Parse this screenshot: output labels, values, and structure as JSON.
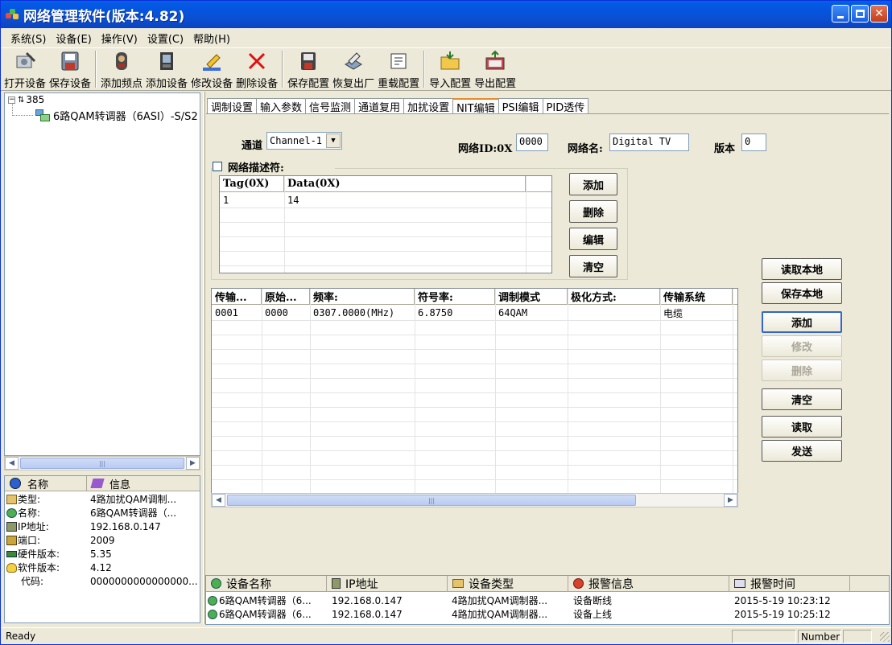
{
  "window": {
    "title": "网络管理软件(版本:4.82)"
  },
  "menu": [
    "系统(S)",
    "设备(E)",
    "操作(V)",
    "设置(C)",
    "帮助(H)"
  ],
  "toolbar": [
    {
      "label": "打开设备",
      "icon": "open-device-icon"
    },
    {
      "label": "保存设备",
      "icon": "save-device-icon"
    },
    {
      "label": "添加频点",
      "icon": "add-frequency-icon"
    },
    {
      "label": "添加设备",
      "icon": "add-device-icon"
    },
    {
      "label": "修改设备",
      "icon": "edit-device-icon"
    },
    {
      "label": "删除设备",
      "icon": "delete-device-icon"
    },
    {
      "label": "保存配置",
      "icon": "save-config-icon"
    },
    {
      "label": "恢复出厂",
      "icon": "factory-reset-icon"
    },
    {
      "label": "重载配置",
      "icon": "reload-config-icon"
    },
    {
      "label": "导入配置",
      "icon": "import-config-icon"
    },
    {
      "label": "导出配置",
      "icon": "export-config-icon"
    }
  ],
  "tree": {
    "root": "385",
    "child": "6路QAM转调器（6ASI）-S/S2"
  },
  "info": {
    "headers": [
      "名称",
      "信息"
    ],
    "rows": [
      {
        "k": "类型:",
        "v": "4路加扰QAM调制..."
      },
      {
        "k": "名称:",
        "v": "6路QAM转调器（..."
      },
      {
        "k": "IP地址:",
        "v": "192.168.0.147"
      },
      {
        "k": "端口:",
        "v": "2009"
      },
      {
        "k": "硬件版本:",
        "v": "5.35"
      },
      {
        "k": "软件版本:",
        "v": "4.12"
      },
      {
        "k": "代码:",
        "v": "0000000000000000..."
      }
    ]
  },
  "tabs": [
    "调制设置",
    "输入参数",
    "信号监测",
    "通道复用",
    "加扰设置",
    "NIT编辑",
    "PSI编辑",
    "PID透传"
  ],
  "active_tab": "NIT编辑",
  "nit": {
    "channel_label": "通道",
    "channel_value": "Channel-1",
    "network_id_label": "网络ID:0X",
    "network_id_value": "0000",
    "network_name_label": "网络名:",
    "network_name_value": "Digital TV",
    "version_label": "版本",
    "version_value": "0",
    "descriptor_label": "网络描述符:",
    "desc_headers": [
      "Tag(0X)",
      "Data(0X)"
    ],
    "desc_rows": [
      [
        "1",
        "14"
      ]
    ],
    "desc_buttons": [
      "添加",
      "删除",
      "编辑",
      "清空"
    ],
    "ts_headers": [
      "传输...",
      "原始...",
      "频率:",
      "符号率:",
      "调制模式",
      "极化方式:",
      "传输系统"
    ],
    "ts_rows": [
      [
        "0001",
        "0000",
        "0307.0000(MHz)",
        "6.8750",
        "64QAM",
        "",
        "电缆"
      ]
    ],
    "side_buttons": [
      {
        "label": "读取本地",
        "enabled": true
      },
      {
        "label": "保存本地",
        "enabled": true
      },
      {
        "label": "添加",
        "enabled": true
      },
      {
        "label": "修改",
        "enabled": false
      },
      {
        "label": "删除",
        "enabled": false
      },
      {
        "label": "清空",
        "enabled": true
      },
      {
        "label": "读取",
        "enabled": true
      },
      {
        "label": "发送",
        "enabled": true
      }
    ]
  },
  "alarms": {
    "headers": [
      "设备名称",
      "IP地址",
      "设备类型",
      "报警信息",
      "报警时间"
    ],
    "rows": [
      [
        "6路QAM转调器（6...",
        "192.168.0.147",
        "4路加扰QAM调制器...",
        "设备断线",
        "2015-5-19 10:23:12"
      ],
      [
        "6路QAM转调器（6...",
        "192.168.0.147",
        "4路加扰QAM调制器...",
        "设备上线",
        "2015-5-19 10:25:12"
      ]
    ]
  },
  "status": {
    "left": "Ready",
    "right": "Number"
  }
}
